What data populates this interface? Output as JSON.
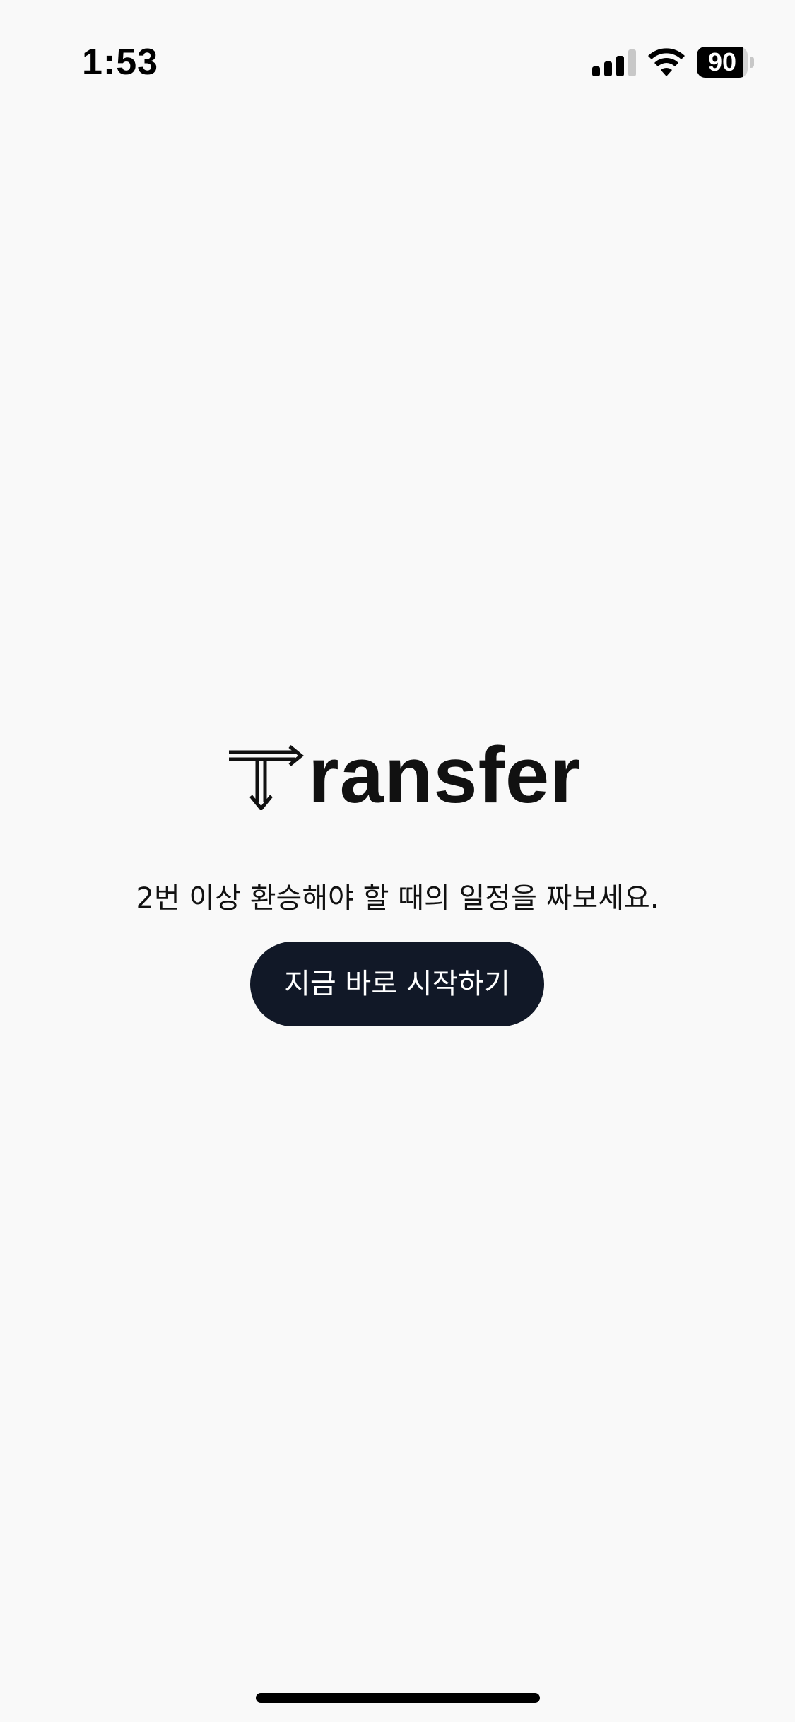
{
  "status_bar": {
    "time": "1:53",
    "battery_level": "90",
    "battery_fraction": 0.9,
    "signal_icon": "cellular-signal-icon",
    "wifi_icon": "wifi-icon"
  },
  "logo": {
    "icon": "transfer-arrows-icon",
    "text": "ransfer"
  },
  "tagline": "2번 이상 환승해야 할 때의 일정을 짜보세요.",
  "start_button": {
    "label": "지금 바로 시작하기"
  },
  "colors": {
    "background": "#f9f9f9",
    "button_bg": "#111827",
    "text": "#111111"
  }
}
